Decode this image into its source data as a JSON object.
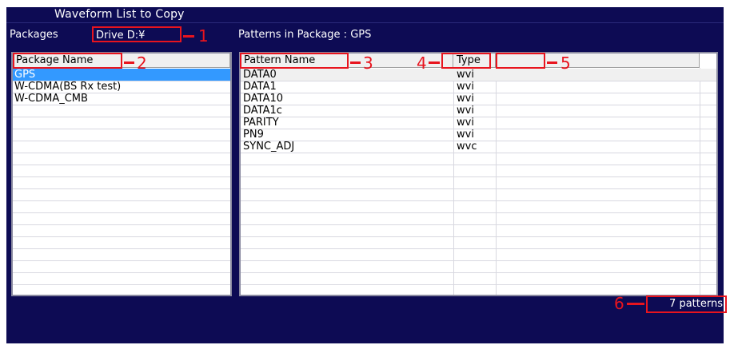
{
  "window": {
    "title": "Waveform List to Copy"
  },
  "packages": {
    "label": "Packages",
    "drive": "Drive D:¥",
    "column_header": "Package Name",
    "items": [
      "GPS",
      "W-CDMA(BS Rx test)",
      "W-CDMA_CMB"
    ],
    "selected": "GPS"
  },
  "patterns": {
    "label": "Patterns in Package : GPS",
    "columns": {
      "name": "Pattern Name",
      "type": "Type",
      "extra": ""
    },
    "rows": [
      {
        "name": "DATA0",
        "type": "wvi"
      },
      {
        "name": "DATA1",
        "type": "wvi"
      },
      {
        "name": "DATA10",
        "type": "wvi"
      },
      {
        "name": "DATA1c",
        "type": "wvi"
      },
      {
        "name": "PARITY",
        "type": "wvi"
      },
      {
        "name": "PN9",
        "type": "wvi"
      },
      {
        "name": "SYNC_ADJ",
        "type": "wvc"
      }
    ],
    "count": "7 patterns"
  },
  "callouts": [
    "1",
    "2",
    "3",
    "4",
    "5",
    "6"
  ],
  "colors": {
    "background": "#0d0b54",
    "callout": "#e8141e",
    "selection": "#3399ff"
  }
}
